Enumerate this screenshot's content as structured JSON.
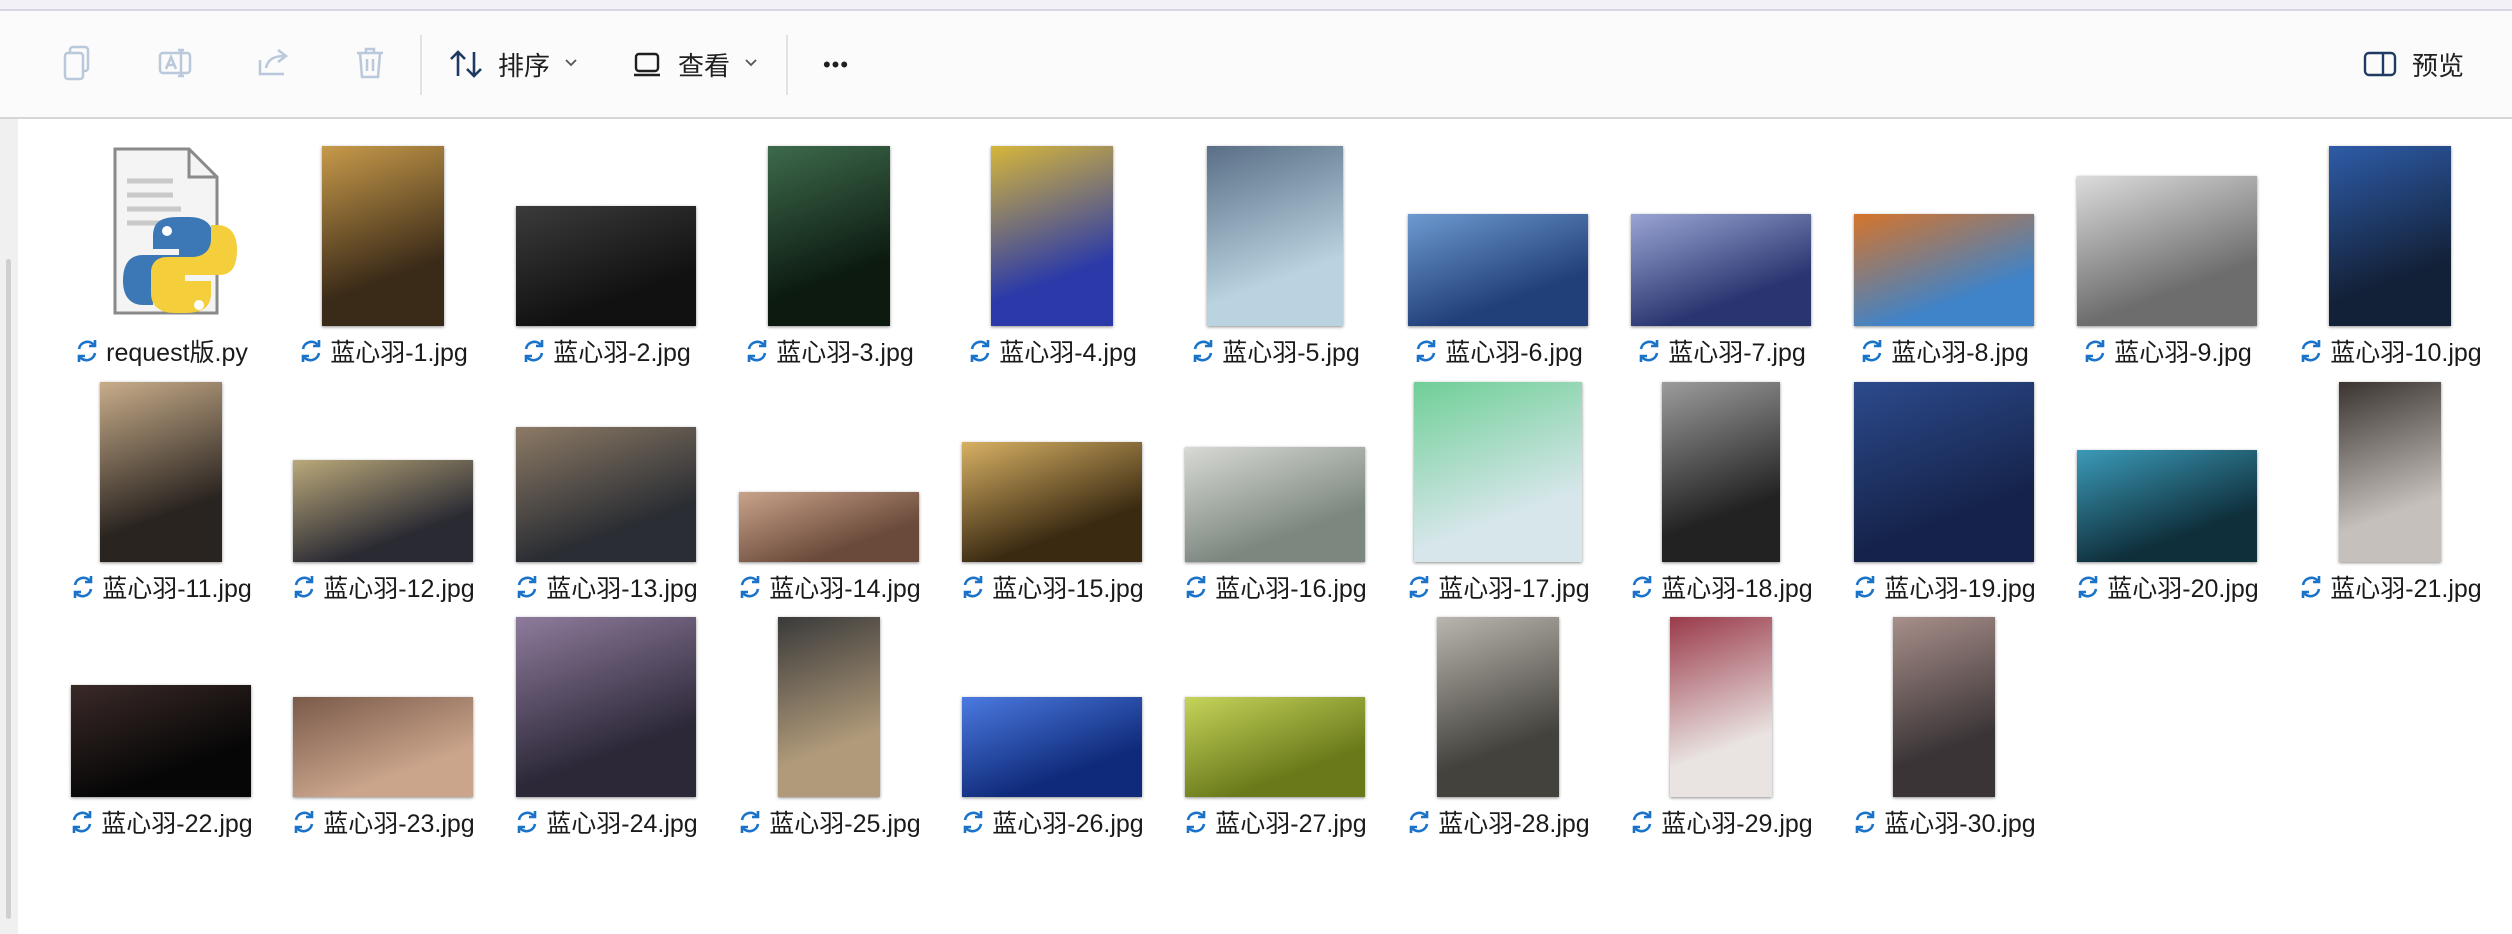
{
  "toolbar": {
    "copy_icon": "copy-icon",
    "rename_icon": "rename-icon",
    "share_icon": "share-icon",
    "delete_icon": "trash-icon",
    "sort_label": "排序",
    "view_label": "查看",
    "more_label": "•••",
    "preview_label": "预览"
  },
  "files": [
    {
      "name": "request版.py",
      "kind": "python",
      "synced": true
    },
    {
      "name": "蓝心羽-1.jpg"
    },
    {
      "name": "蓝心羽-2.jpg"
    },
    {
      "name": "蓝心羽-3.jpg"
    },
    {
      "name": "蓝心羽-4.jpg"
    },
    {
      "name": "蓝心羽-5.jpg"
    },
    {
      "name": "蓝心羽-6.jpg"
    },
    {
      "name": "蓝心羽-7.jpg"
    },
    {
      "name": "蓝心羽-8.jpg"
    },
    {
      "name": "蓝心羽-9.jpg"
    },
    {
      "name": "蓝心羽-10.jpg"
    },
    {
      "name": "蓝心羽-11.jpg"
    },
    {
      "name": "蓝心羽-12.jpg"
    },
    {
      "name": "蓝心羽-13.jpg"
    },
    {
      "name": "蓝心羽-14.jpg"
    },
    {
      "name": "蓝心羽-15.jpg"
    },
    {
      "name": "蓝心羽-16.jpg"
    },
    {
      "name": "蓝心羽-17.jpg"
    },
    {
      "name": "蓝心羽-18.jpg"
    },
    {
      "name": "蓝心羽-19.jpg"
    },
    {
      "name": "蓝心羽-20.jpg"
    },
    {
      "name": "蓝心羽-21.jpg"
    },
    {
      "name": "蓝心羽-22.jpg"
    },
    {
      "name": "蓝心羽-23.jpg"
    },
    {
      "name": "蓝心羽-24.jpg"
    },
    {
      "name": "蓝心羽-25.jpg"
    },
    {
      "name": "蓝心羽-26.jpg"
    },
    {
      "name": "蓝心羽-27.jpg"
    },
    {
      "name": "蓝心羽-28.jpg"
    },
    {
      "name": "蓝心羽-29.jpg"
    },
    {
      "name": "蓝心羽-30.jpg"
    }
  ],
  "colors": {
    "sync_icon": "#1a73c9",
    "toolbar_bg": "#fbfbfb",
    "accent": "#2a66b0"
  }
}
